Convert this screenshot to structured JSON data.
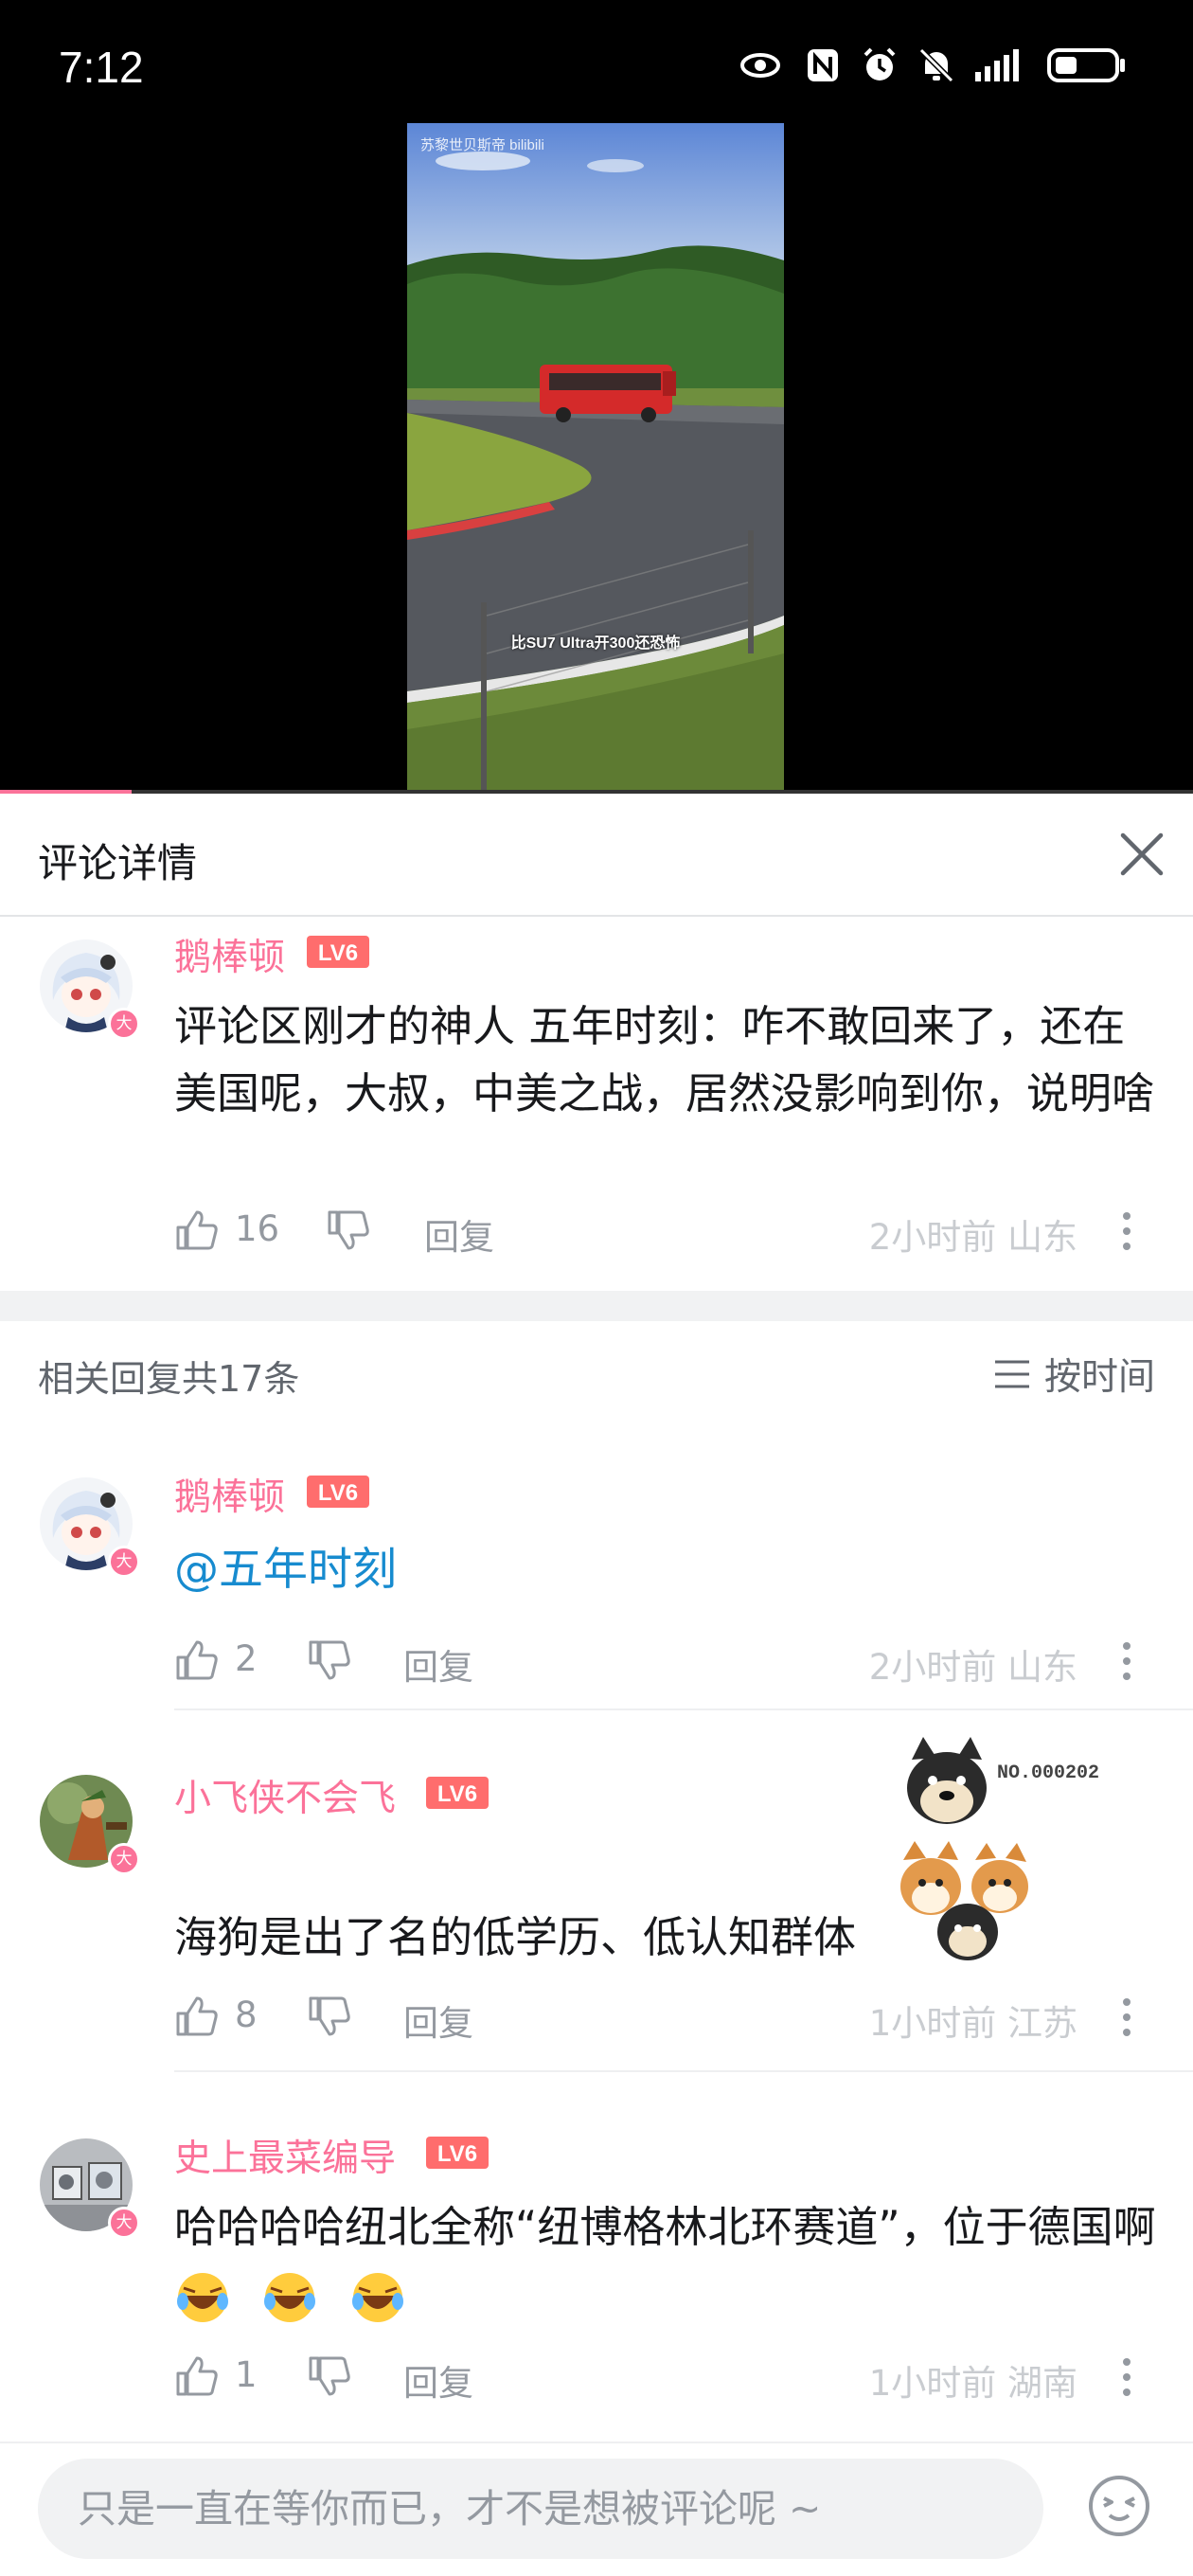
{
  "status_bar": {
    "time": "7:12",
    "icons": [
      "eye-icon",
      "nfc-icon",
      "alarm-icon",
      "mute-icon",
      "signal-icon",
      "battery-icon"
    ]
  },
  "video": {
    "watermark": "苏黎世贝斯帝 bilibili",
    "caption": "比SU7 Ultra开300还恐怖",
    "progress_fraction": 0.11
  },
  "detail_header": {
    "title": "评论详情"
  },
  "main_comment": {
    "username": "鹅棒顿",
    "level": "LV6",
    "badge": "大",
    "text": "评论区刚才的神人 五年时刻：咋不敢回来了，还在美国呢，大叔，中美之战，居然没影响到你，说明啥",
    "likes": "16",
    "reply_label": "回复",
    "time_location": "2小时前 山东"
  },
  "replies_header": {
    "count_label": "相关回复共17条",
    "sort_label": "按时间"
  },
  "replies": [
    {
      "username": "鹅棒顿",
      "level": "LV6",
      "badge": "大",
      "mention": "@五年时刻",
      "likes": "2",
      "reply_label": "回复",
      "time_location": "2小时前 山东"
    },
    {
      "username": "小飞侠不会飞",
      "level": "LV6",
      "badge": "大",
      "text": "海狗是出了名的低学历、低认知群体",
      "sticker_label": "NO.000202",
      "likes": "8",
      "reply_label": "回复",
      "time_location": "1小时前 江苏"
    },
    {
      "username": "史上最菜编导",
      "level": "LV6",
      "badge": "大",
      "text": "哈哈哈哈纽北全称“纽博格林北环赛道”，位于德国啊",
      "likes": "1",
      "reply_label": "回复",
      "time_location": "1小时前 湖南"
    }
  ],
  "input_bar": {
    "placeholder": "只是一直在等你而已，才不是想被评论呢 ~"
  },
  "colors": {
    "brand_pink": "#fb7299",
    "mention_blue": "#178bcf",
    "meta_gray": "#9499a0"
  }
}
